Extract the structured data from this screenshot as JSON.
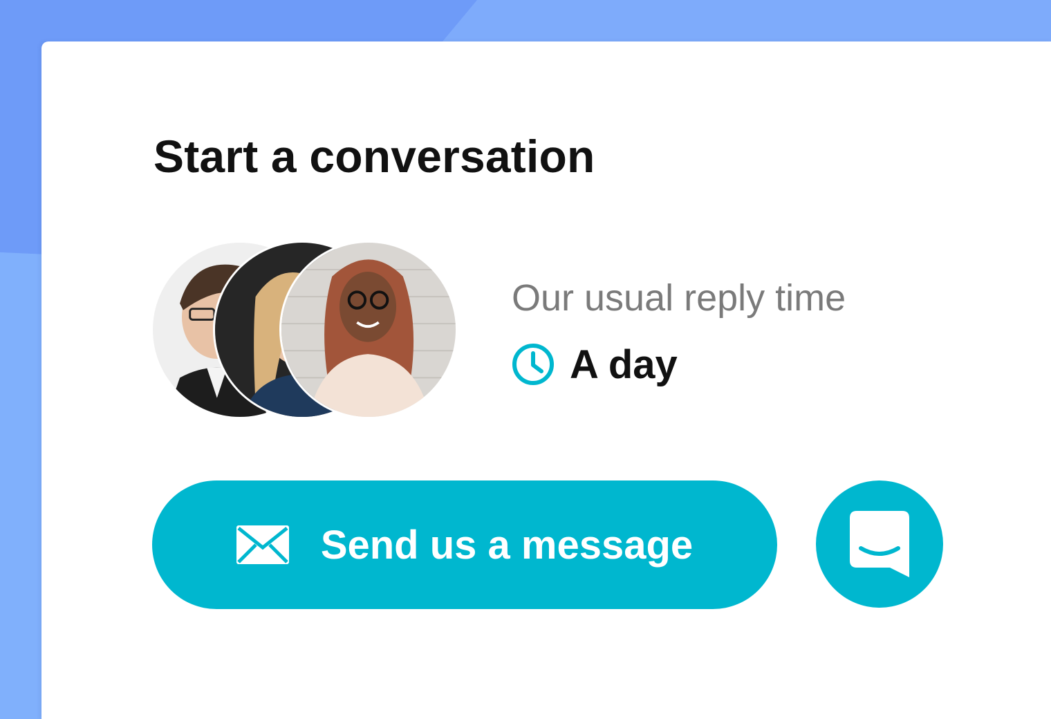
{
  "widget": {
    "title": "Start a conversation",
    "reply_label": "Our usual reply time",
    "reply_value": "A day",
    "send_button_label": "Send us a message"
  },
  "icons": {
    "clock": "clock-icon",
    "mail": "mail-icon",
    "launcher": "chat-bubble-icon"
  },
  "colors": {
    "accent": "#00b7cf",
    "background": "#7eabfb",
    "card": "#ffffff",
    "title_text": "#111111",
    "muted_text": "#7a7a7a"
  },
  "team_avatars": [
    {
      "description_name": "avatar-1"
    },
    {
      "description_name": "avatar-2"
    },
    {
      "description_name": "avatar-3"
    }
  ]
}
